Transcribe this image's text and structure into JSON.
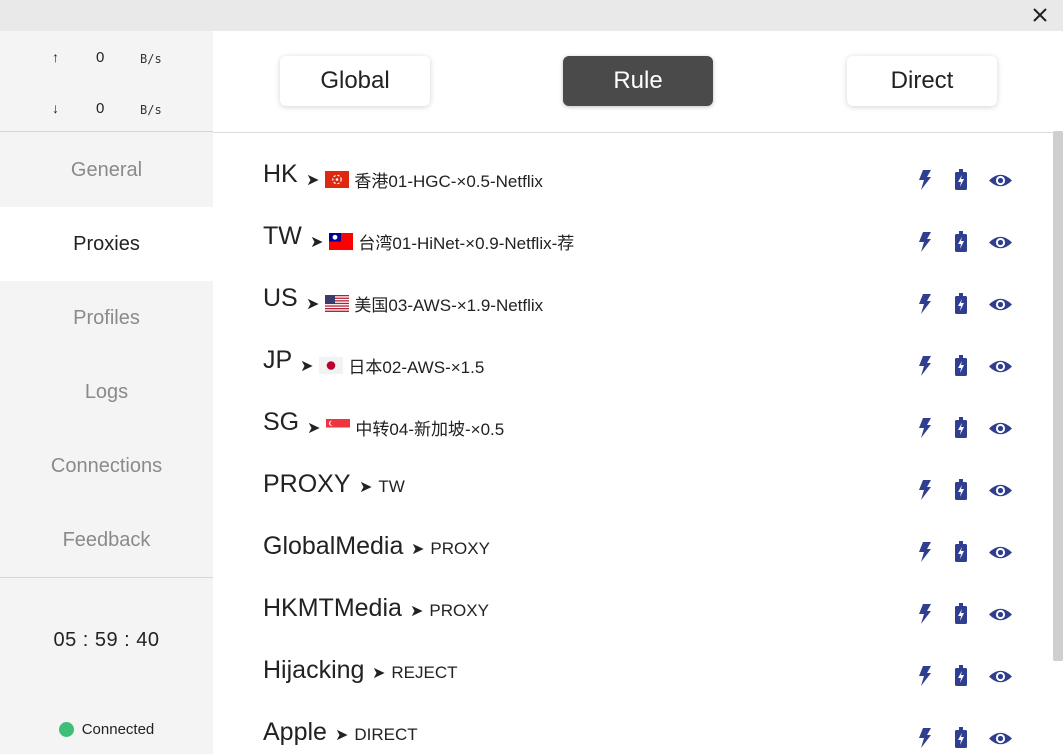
{
  "window": {
    "close_glyph": "✕"
  },
  "traffic": {
    "upload": {
      "arrow": "↑",
      "value": "0",
      "unit": "B/s"
    },
    "download": {
      "arrow": "↓",
      "value": "0",
      "unit": "B/s"
    }
  },
  "nav": {
    "items": [
      {
        "label": "General"
      },
      {
        "label": "Proxies"
      },
      {
        "label": "Profiles"
      },
      {
        "label": "Logs"
      },
      {
        "label": "Connections"
      },
      {
        "label": "Feedback"
      }
    ],
    "active": "Proxies"
  },
  "timer": "05 : 59 : 40",
  "status": {
    "label": "Connected",
    "color": "#3dbf7a"
  },
  "modes": {
    "items": [
      {
        "label": "Global"
      },
      {
        "label": "Rule"
      },
      {
        "label": "Direct"
      }
    ],
    "active": "Rule"
  },
  "proxy_groups": [
    {
      "name": "HK",
      "selected": "香港01-HGC-×0.5-Netflix",
      "flag": "hk"
    },
    {
      "name": "TW",
      "selected": "台湾01-HiNet-×0.9-Netflix-荐",
      "flag": "tw"
    },
    {
      "name": "US",
      "selected": "美国03-AWS-×1.9-Netflix",
      "flag": "us"
    },
    {
      "name": "JP",
      "selected": "日本02-AWS-×1.5",
      "flag": "jp"
    },
    {
      "name": "SG",
      "selected": "中转04-新加坡-×0.5",
      "flag": "sg"
    },
    {
      "name": "PROXY",
      "selected": "TW",
      "flag": ""
    },
    {
      "name": "GlobalMedia",
      "selected": "PROXY",
      "flag": ""
    },
    {
      "name": "HKMTMedia",
      "selected": "PROXY",
      "flag": ""
    },
    {
      "name": "Hijacking",
      "selected": "REJECT",
      "flag": ""
    },
    {
      "name": "Apple",
      "selected": "DIRECT",
      "flag": ""
    }
  ],
  "row_actions": [
    "lightning-icon",
    "battery-bolt-icon",
    "eye-icon"
  ],
  "colors": {
    "action_icon": "#2f3e8f",
    "active_mode_bg": "#4a4a4a"
  }
}
